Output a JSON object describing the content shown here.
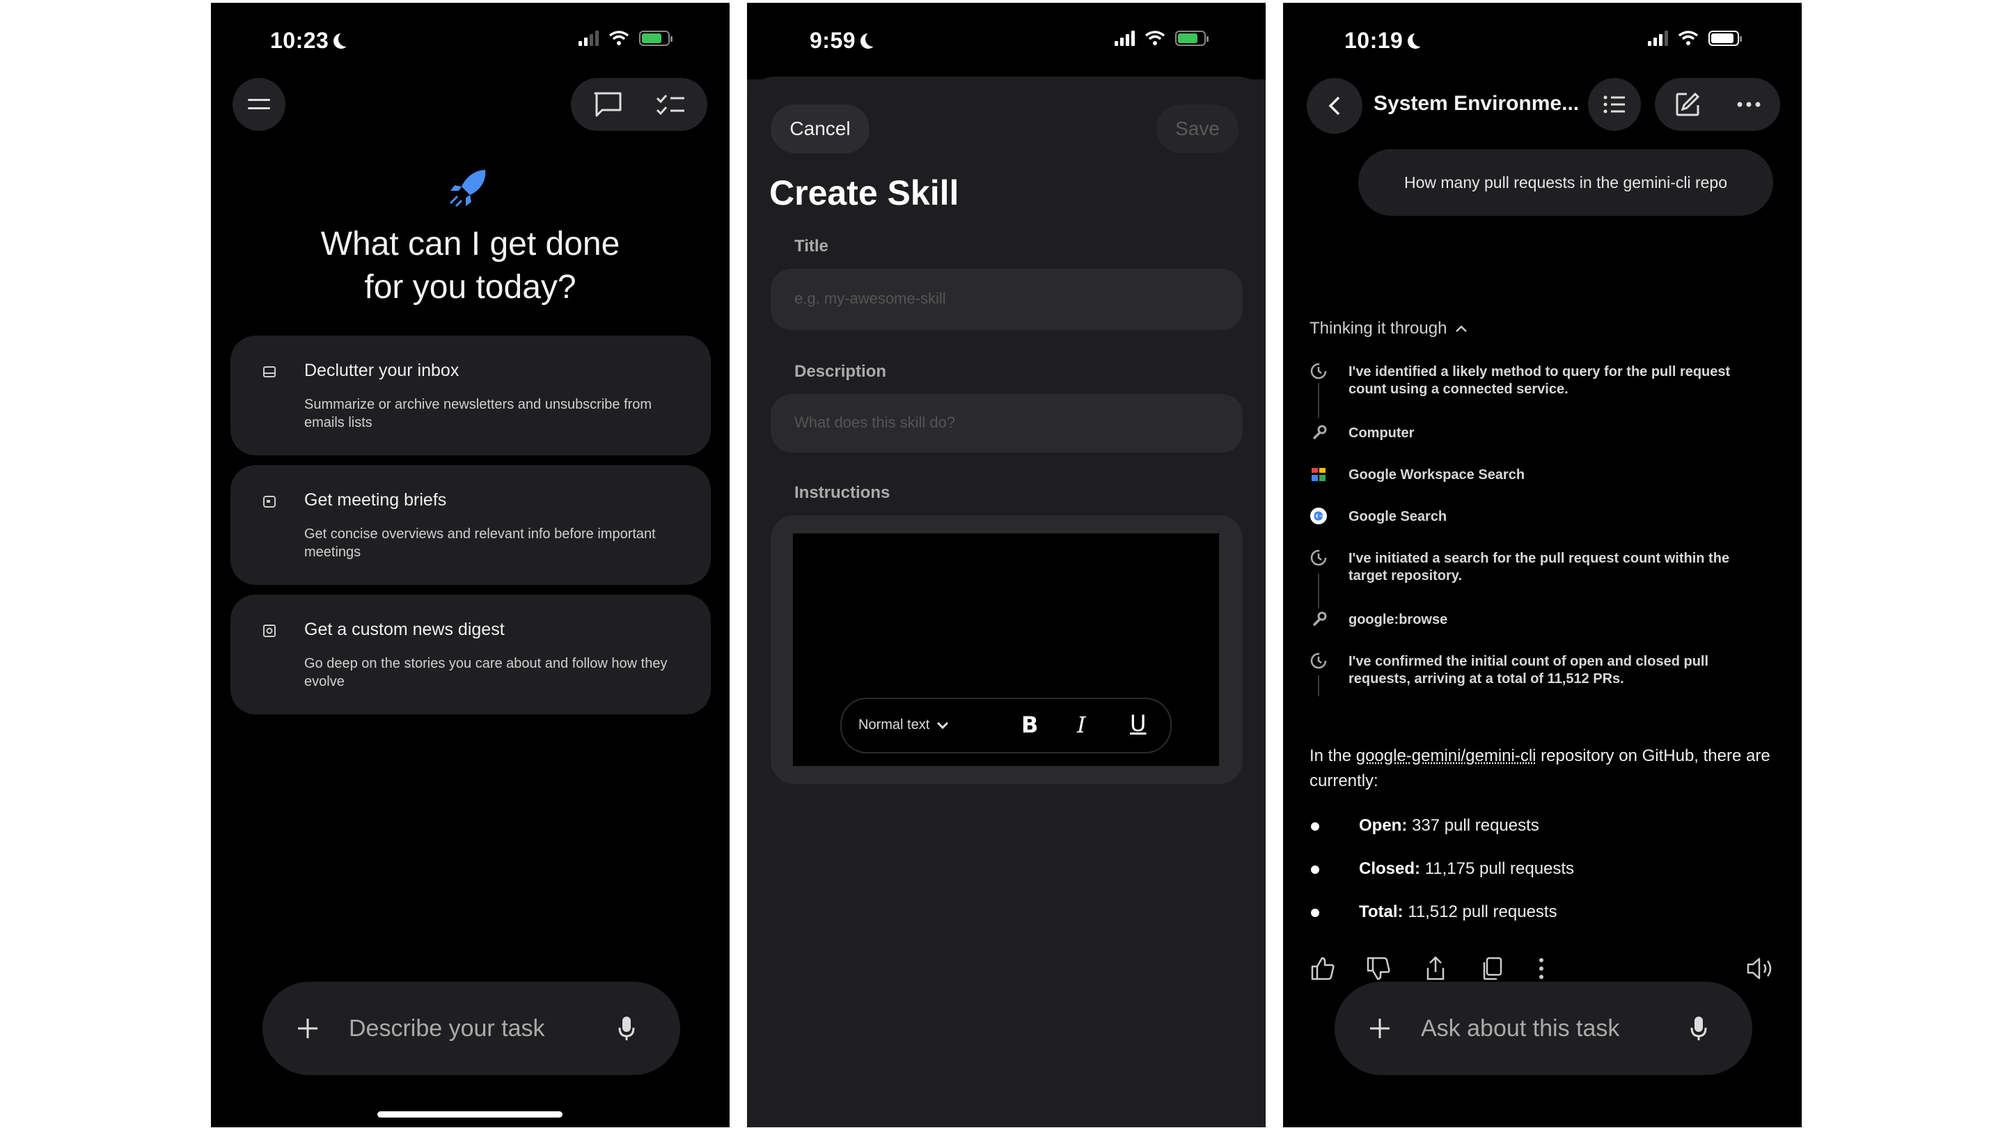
{
  "screen1": {
    "status_time": "10:23",
    "heading_line1": "What can I get done",
    "heading_line2": "for you today?",
    "cards": [
      {
        "title": "Declutter your inbox",
        "desc": "Summarize or archive newsletters and unsubscribe from emails lists",
        "icon": "inbox-icon"
      },
      {
        "title": "Get meeting briefs",
        "desc": "Get concise overviews and relevant info before important meetings",
        "icon": "calendar-icon"
      },
      {
        "title": "Get a custom news digest",
        "desc": "Go deep on the stories you care about and follow how they evolve",
        "icon": "news-icon"
      }
    ],
    "input_placeholder": "Describe your task",
    "accent_color": "#4a8ff5"
  },
  "screen2": {
    "status_time": "9:59",
    "cancel_label": "Cancel",
    "save_label": "Save",
    "title": "Create Skill",
    "title_label": "Title",
    "title_placeholder": "e.g. my-awesome-skill",
    "description_label": "Description",
    "description_placeholder": "What does this skill do?",
    "instructions_label": "Instructions",
    "text_style": "Normal text",
    "bold": "B",
    "italic": "I",
    "underline": "U"
  },
  "screen3": {
    "status_time": "10:19",
    "header_title": "System Environme...",
    "user_message": "How many pull requests in the gemini-cli repo",
    "thinking_label": "Thinking it through",
    "steps": [
      {
        "text": "I've identified a likely method to query for the pull request count using a connected service.",
        "icon": "clock-icon"
      },
      {
        "text": "Computer",
        "icon": "wrench-icon"
      },
      {
        "text": "Google Workspace Search",
        "icon": "workspace-icon"
      },
      {
        "text": "Google Search",
        "icon": "google-icon"
      },
      {
        "text": "I've initiated a search for the pull request count within the target repository.",
        "icon": "clock-icon"
      },
      {
        "text": "google:browse",
        "icon": "wrench-icon"
      },
      {
        "text": "I've confirmed the initial count of open and closed pull requests, arriving at a total of 11,512 PRs.",
        "icon": "clock-icon"
      }
    ],
    "answer_prefix": "In the ",
    "answer_link": "google-gemini/gemini-cli",
    "answer_suffix": " repository on GitHub, there are currently:",
    "bullets": [
      {
        "label": "Open:",
        "value": "337 pull requests"
      },
      {
        "label": "Closed:",
        "value": "11,175 pull requests"
      },
      {
        "label": "Total:",
        "value": "11,512 pull requests"
      }
    ],
    "input_placeholder": "Ask about this task"
  }
}
